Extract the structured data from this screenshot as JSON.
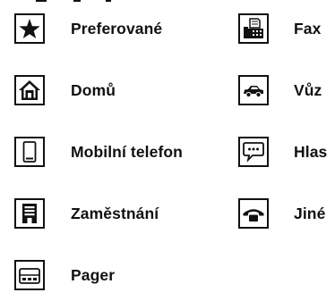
{
  "left_column": [
    {
      "label": "Preferované",
      "icon": "star-icon"
    },
    {
      "label": "Domů",
      "icon": "home-icon"
    },
    {
      "label": "Mobilní telefon",
      "icon": "mobile-phone-icon"
    },
    {
      "label": "Zaměstnání",
      "icon": "office-building-icon"
    },
    {
      "label": "Pager",
      "icon": "pager-icon"
    }
  ],
  "right_column": [
    {
      "label": "Fax",
      "icon": "fax-icon"
    },
    {
      "label": "Vůz",
      "icon": "car-icon"
    },
    {
      "label": "Hlas",
      "icon": "speech-bubble-icon"
    },
    {
      "label": "Jiné",
      "icon": "telephone-handset-icon"
    }
  ]
}
